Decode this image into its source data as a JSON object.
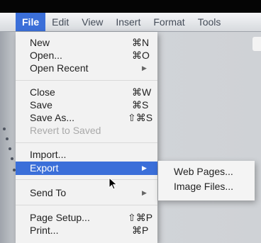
{
  "menubar": {
    "items": [
      {
        "label": "File",
        "active": true
      },
      {
        "label": "Edit"
      },
      {
        "label": "View"
      },
      {
        "label": "Insert"
      },
      {
        "label": "Format"
      },
      {
        "label": "Tools"
      }
    ]
  },
  "file_menu": {
    "new": {
      "label": "New",
      "shortcut": "⌘N"
    },
    "open": {
      "label": "Open...",
      "shortcut": "⌘O"
    },
    "open_recent": {
      "label": "Open Recent",
      "submenu_icon": "triangle-right-icon"
    },
    "close": {
      "label": "Close",
      "shortcut": "⌘W"
    },
    "save": {
      "label": "Save",
      "shortcut": "⌘S"
    },
    "save_as": {
      "label": "Save As...",
      "shortcut": "⇧⌘S"
    },
    "revert": {
      "label": "Revert to Saved",
      "disabled": true
    },
    "import": {
      "label": "Import..."
    },
    "export": {
      "label": "Export",
      "highlighted": true,
      "submenu_icon": "triangle-right-icon"
    },
    "send_to": {
      "label": "Send To",
      "submenu_icon": "triangle-right-icon"
    },
    "page_setup": {
      "label": "Page Setup...",
      "shortcut": "⇧⌘P"
    },
    "print": {
      "label": "Print...",
      "shortcut": "⌘P"
    }
  },
  "export_submenu": {
    "web_pages": {
      "label": "Web Pages..."
    },
    "image_files": {
      "label": "Image Files..."
    }
  },
  "colors": {
    "highlight": "#3b6fd9",
    "menu_bg": "#f2f2f2",
    "disabled_text": "#a9a9a9"
  },
  "arrow_glyph": "▶"
}
